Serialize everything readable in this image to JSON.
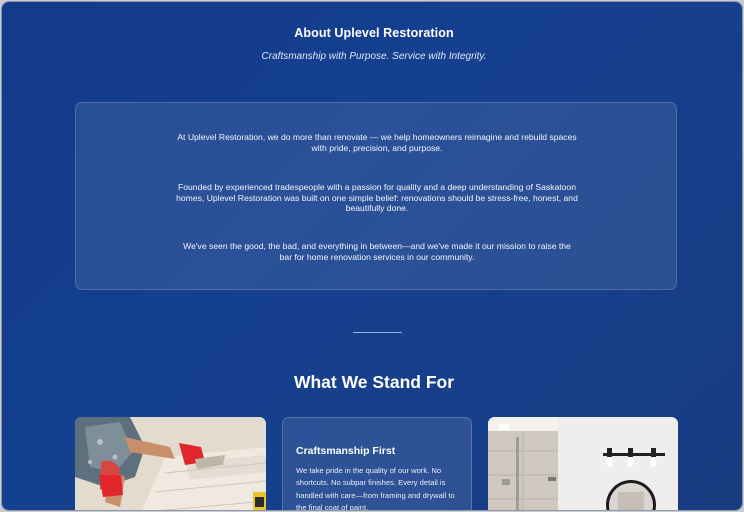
{
  "about": {
    "title": "About Uplevel Restoration",
    "subtitle": "Craftsmanship with Purpose. Service with Integrity.",
    "paragraphs": [
      "At Uplevel Restoration, we do more than renovate — we help homeowners reimagine and rebuild spaces with pride, precision, and purpose.",
      "Founded by experienced tradespeople with a passion for quality and a deep understanding of Saskatoon homes, Uplevel Restoration was built on one simple belief: renovations should be stress-free, honest, and beautifully done.",
      "We've seen the good, the bad, and everything in between—and we've made it our mission to raise the bar for home renovation services in our community."
    ]
  },
  "values": {
    "title": "What We Stand For",
    "cards": [
      {
        "heading": "Craftsmanship First",
        "body": "We take pride in the quality of our work. No shortcuts. No subpar finishes. Every detail is handled with care—from framing and drywall to the final coat of paint."
      }
    ]
  },
  "colors": {
    "background": "#15408f",
    "accent_glove": "#e0262a"
  }
}
